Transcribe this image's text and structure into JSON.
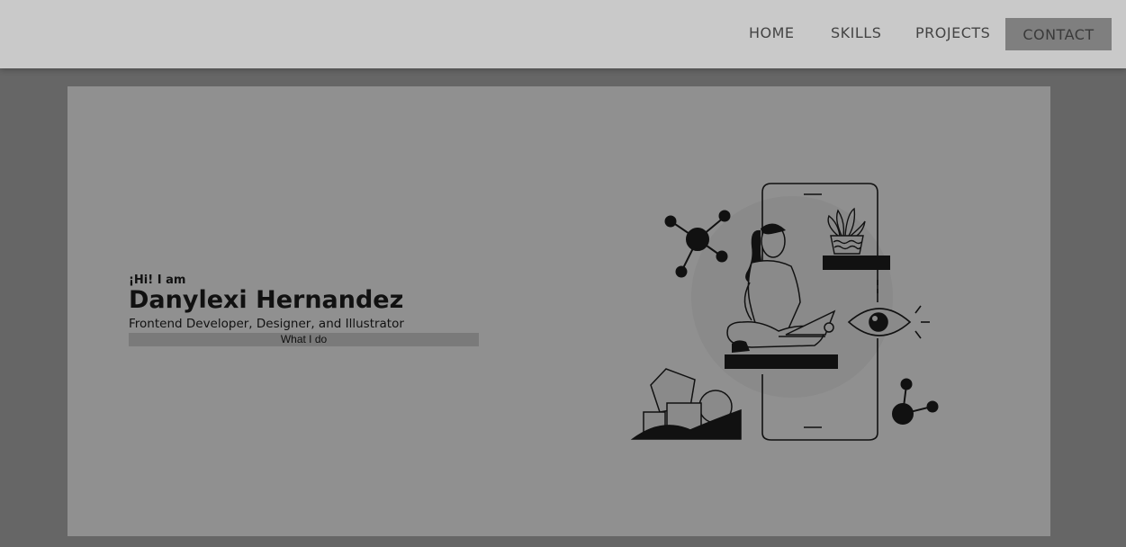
{
  "nav": {
    "home": "HOME",
    "skills": "SKILLS",
    "projects": "PROJECTS",
    "contact": "CONTACT"
  },
  "hero": {
    "greeting": "¡Hi! I am",
    "name": "Danylexi Hernandez",
    "subtitle": "Frontend Developer, Designer, and Illustrator",
    "cta": "What I do"
  },
  "colors": {
    "navbar_bg": "#c9c9c9",
    "page_bg": "#666666",
    "hero_bg": "#909090",
    "contact_bg": "#7f7f7f",
    "cta_bg": "#7a7a7a"
  },
  "illustration": {
    "icons": [
      "molecule-icon",
      "phone-frame",
      "plant-icon",
      "woman-with-laptop",
      "eye-icon",
      "shapes-icon"
    ]
  }
}
